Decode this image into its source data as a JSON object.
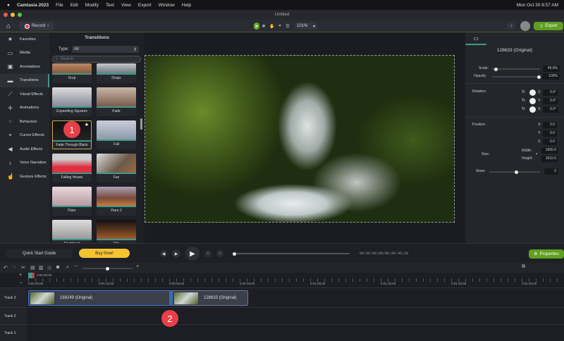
{
  "menubar": {
    "app": "Camtasia 2023",
    "items": [
      "File",
      "Edit",
      "Modify",
      "Text",
      "View",
      "Export",
      "Window",
      "Help"
    ],
    "datetime": "Mon Oct 30  8:57 AM"
  },
  "window": {
    "title": "Untitled"
  },
  "toolbar": {
    "record": "Record",
    "zoom": "101%",
    "export": "Export"
  },
  "sidebar": {
    "items": [
      "Favorites",
      "Media",
      "Annotations",
      "Transitions",
      "Visual Effects",
      "Animations",
      "Behaviors",
      "Cursor Effects",
      "Audio Effects",
      "Voice Narration",
      "Gesture Effects"
    ]
  },
  "transitions": {
    "title": "Transitions",
    "type_label": "Type:",
    "type_value": "All",
    "search_placeholder": "Search",
    "items": [
      "Drop",
      "Drops",
      "Expanding Squares",
      "Fade",
      "Fade Through Black",
      "Fall",
      "Falling Hearts",
      "Fan",
      "Flare",
      "Flare 2",
      "Flashback",
      "Flip"
    ]
  },
  "properties": {
    "clip_name": "128633 (Original)",
    "scale_label": "Scale:",
    "scale": "46.9%",
    "scale_level": 0.05,
    "opacity_label": "Opacity:",
    "opacity": "100%",
    "opacity_level": 1.0,
    "rotation_label": "Rotation:",
    "rotation": {
      "z": "0.0°",
      "y": "0.0°",
      "x": "0.0°"
    },
    "position_label": "Position:",
    "position": {
      "x": "0.0",
      "y": "0.0",
      "z": "0.0"
    },
    "size_label": "Size:",
    "width_label": "Width:",
    "width": "1800.0",
    "height_label": "Height:",
    "height": "1010.0",
    "skew_label": "Skew:",
    "skew": "0",
    "skew_level": 0.5,
    "axis": {
      "z": "Z:",
      "y": "Y:",
      "x": "X:"
    }
  },
  "controls": {
    "quick_start": "Quick Start Guide",
    "buy_now": "Buy Now!",
    "timecode": "00:00:00;00/00:00:46;28",
    "properties": "Properties",
    "progress": 0.0
  },
  "timeline": {
    "playhead": "0:00:00;00",
    "ticks": [
      "0:00:00;00",
      "0:00:15;00",
      "0:00:30;00",
      "0:00:45;00",
      "0:01:00;00",
      "0:01:15;00",
      "0:01:30;00",
      "0:01:45;00"
    ],
    "tracks": [
      "Track 3",
      "Track 2",
      "Track 1"
    ],
    "clips": [
      "169249 (Original)",
      "128633 (Original)"
    ]
  },
  "badges": [
    "1",
    "2"
  ]
}
